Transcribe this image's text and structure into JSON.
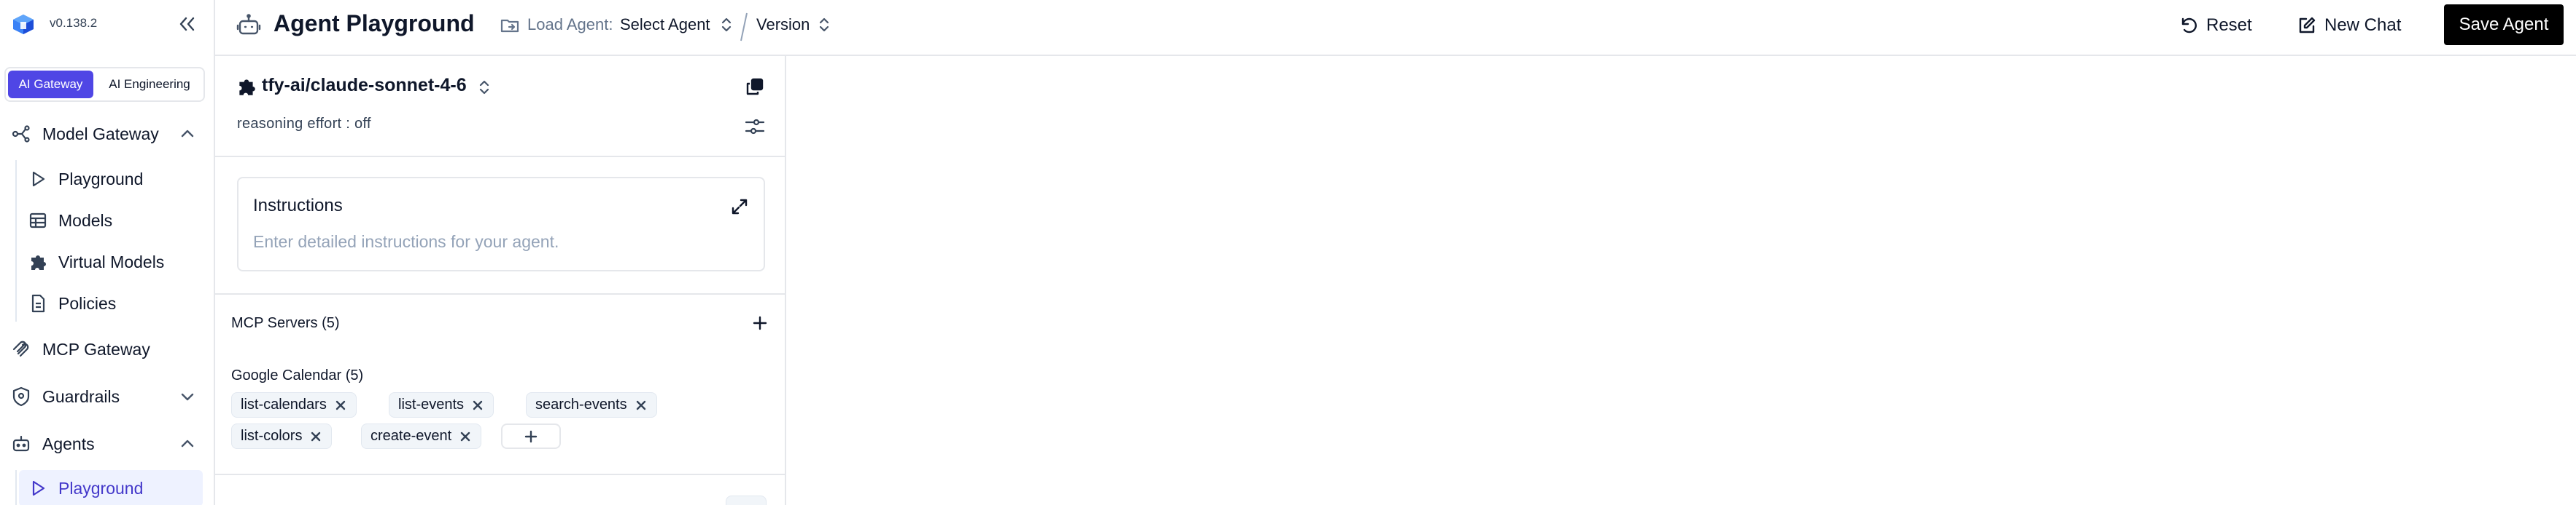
{
  "app": {
    "version": "v0.138.2",
    "colors": {
      "accent": "#4f46e5",
      "active_bg": "#eef2ff",
      "border": "#e5e7eb",
      "muted": "#64748b"
    }
  },
  "sidebar": {
    "segments": [
      {
        "label": "AI Gateway",
        "active": true
      },
      {
        "label": "AI Engineering",
        "active": false
      }
    ],
    "groups": [
      {
        "label": "Model Gateway",
        "icon": "network-icon",
        "expanded": true,
        "items": [
          {
            "label": "Playground",
            "icon": "play-icon"
          },
          {
            "label": "Models",
            "icon": "table-icon"
          },
          {
            "label": "Virtual Models",
            "icon": "puzzle-icon"
          },
          {
            "label": "Policies",
            "icon": "document-icon"
          }
        ]
      },
      {
        "label": "MCP Gateway",
        "icon": "mcp-icon"
      },
      {
        "label": "Guardrails",
        "icon": "shield-icon",
        "expanded": false
      },
      {
        "label": "Agents",
        "icon": "robot-icon",
        "expanded": true,
        "items": [
          {
            "label": "Playground",
            "icon": "play-icon",
            "active": true
          }
        ]
      }
    ]
  },
  "header": {
    "title": "Agent Playground",
    "load_agent_label": "Load Agent:",
    "select_agent": "Select Agent",
    "version_label": "Version",
    "reset_label": "Reset",
    "new_chat_label": "New Chat",
    "save_label": "Save Agent"
  },
  "config": {
    "model": "tfy-ai/claude-sonnet-4-6",
    "reasoning": "reasoning effort : off",
    "instructions": {
      "title": "Instructions",
      "placeholder": "Enter detailed instructions for your agent."
    },
    "mcp": {
      "title": "MCP Servers (5)",
      "servers": [
        {
          "name": "Google Calendar (5)",
          "tools": [
            "list-calendars",
            "list-events",
            "search-events",
            "list-colors",
            "create-event"
          ]
        }
      ]
    }
  }
}
